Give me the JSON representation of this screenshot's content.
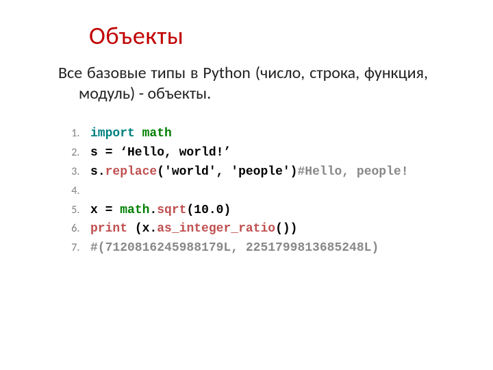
{
  "title": "Объекты",
  "subtitle": "Все базовые типы в Python (число, строка, функция, модуль) - объекты.",
  "code": {
    "l1": {
      "import": "import",
      "space": " ",
      "module": "math"
    },
    "l2": {
      "text": "s = ‘Hello, world!’"
    },
    "l3": {
      "obj": "s",
      "dot": ".",
      "method": "replace",
      "args": "('world', 'people')",
      "comment": "#Hello, people!"
    },
    "l4": {
      "text": " "
    },
    "l5": {
      "lhs": "x = ",
      "mod": "math",
      "dot": ".",
      "fn": "sqrt",
      "args": "(10.0)"
    },
    "l6": {
      "print": "print",
      "sp": " (",
      "obj": "x",
      "dot": ".",
      "method": "as_integer_ratio",
      "tail": "())"
    },
    "l7": {
      "comment": "#(7120816245988179L, 2251799813685248L)"
    }
  }
}
